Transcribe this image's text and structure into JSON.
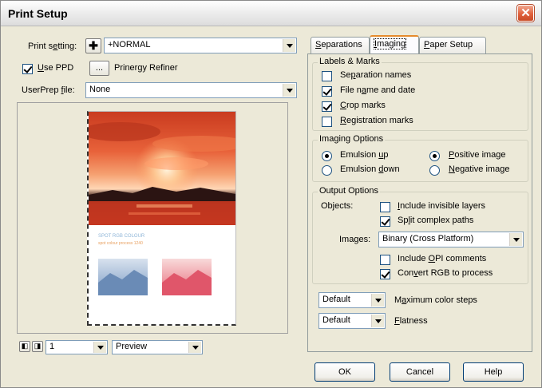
{
  "window": {
    "title": "Print Setup"
  },
  "print_setting": {
    "label": "Print setting:",
    "value": "+NORMAL"
  },
  "use_ppd": {
    "label": "Use PPD",
    "checked": true,
    "browse": "...",
    "value": "Prinergy Refiner"
  },
  "userprep": {
    "label": "UserPrep file:",
    "value": "None"
  },
  "preview_text": {
    "line1": "SPOT RGB COLOUR",
    "line2": "spot colour process 1240"
  },
  "pager": {
    "page": "1",
    "mode": "Preview"
  },
  "tabs": [
    {
      "label": "Separations",
      "active": false
    },
    {
      "label": "Imaging",
      "active": true
    },
    {
      "label": "Paper Setup",
      "active": false
    }
  ],
  "labels_marks": {
    "title": "Labels & Marks",
    "items": [
      {
        "label": "Separation names",
        "checked": false
      },
      {
        "label": "File name and date",
        "checked": true
      },
      {
        "label": "Crop marks",
        "checked": true
      },
      {
        "label": "Registration marks",
        "checked": false
      }
    ]
  },
  "imaging_options": {
    "title": "Imaging Options",
    "emulsion_up": "Emulsion up",
    "emulsion_down": "Emulsion down",
    "positive": "Positive image",
    "negative": "Negative image"
  },
  "output_options": {
    "title": "Output Options",
    "objects_label": "Objects:",
    "include_invisible": "Include invisible layers",
    "split_paths": "Split complex paths",
    "images_label": "Images:",
    "images_value": "Binary (Cross Platform)",
    "include_opi": "Include OPI comments",
    "convert_rgb": "Convert RGB to process"
  },
  "max_steps": {
    "value": "Default",
    "label": "Maximum color steps"
  },
  "flatness": {
    "value": "Default",
    "label": "Flatness"
  },
  "buttons": {
    "ok": "OK",
    "cancel": "Cancel",
    "help": "Help"
  }
}
